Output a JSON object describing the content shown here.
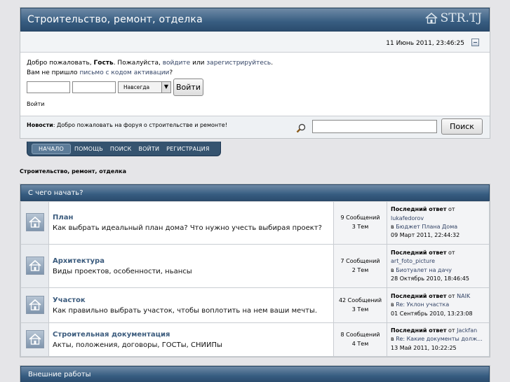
{
  "header": {
    "title": "Строительство, ремонт, отделка",
    "logo_text": "STR.TJ"
  },
  "date": "11 Июнь 2011, 23:46:25",
  "login": {
    "line1_prefix": "Добро пожаловать, ",
    "guest": "Гость",
    "line1_mid": ". Пожалуйста, ",
    "login_link": "войдите",
    "or": " или ",
    "register_link": "зарегистрируйтесь",
    "dot": ".",
    "line2_prefix": "Вам не пришло ",
    "activation_link": "письмо с кодом активации",
    "q": "?",
    "duration_option": "Навсегда",
    "login_button": "Войти",
    "caption": "Войти"
  },
  "news": {
    "label": "Новости",
    "text": ": Добро пожаловать на форуя о строительстве и ремонте!"
  },
  "search": {
    "button": "Поиск"
  },
  "menu": [
    "НАЧАЛО",
    "ПОМОЩЬ",
    "ПОИСК",
    "ВОЙТИ",
    "РЕГИСТРАЦИЯ"
  ],
  "linktree": "Строительство, ремонт, отделка",
  "categories": [
    {
      "title": "С чего начать?",
      "boards": [
        {
          "name": "План",
          "desc": "Как выбрать идеальный план дома? Что нужно учесть выбирая проект?",
          "posts": "9 Сообщений",
          "topics": "3 Тем",
          "last_label": "Последний ответ",
          "last_from": "от",
          "last_user": "lukafedorov",
          "last_in": "в",
          "last_topic": "Бюджет Плана Дома",
          "last_date": "09 Март 2011, 22:44:32"
        },
        {
          "name": "Архитектура",
          "desc": "Виды проектов, особенности, ньансы",
          "posts": "7 Сообщений",
          "topics": "2 Тем",
          "last_label": "Последний ответ",
          "last_from": "от",
          "last_user": "art_foto_picture",
          "last_in": "в",
          "last_topic": "Биотуалет на дачу",
          "last_date": "28 Октябрь 2010, 18:46:45"
        },
        {
          "name": "Участок",
          "desc": "Как правильно выбрать участок, чтобы воплотить на нем ваши мечты.",
          "posts": "42 Сообщений",
          "topics": "3 Тем",
          "last_label": "Последний ответ",
          "last_from": "от",
          "last_user": "NAIK",
          "last_in": "в",
          "last_topic": "Re: Уклон участка",
          "last_date": "01 Сентябрь 2010, 13:23:08"
        },
        {
          "name": "Строительная документация",
          "desc": "Акты, положения, договоры, ГОСТы, СНИИПы",
          "posts": "8 Сообщений",
          "topics": "4 Тем",
          "last_label": "Последний ответ",
          "last_from": "от",
          "last_user": "Jackfan",
          "last_in": "в",
          "last_topic": "Re: Какие документы долж...",
          "last_date": "13 Май 2011, 10:22:25"
        }
      ]
    },
    {
      "title": "Внешние работы"
    }
  ]
}
